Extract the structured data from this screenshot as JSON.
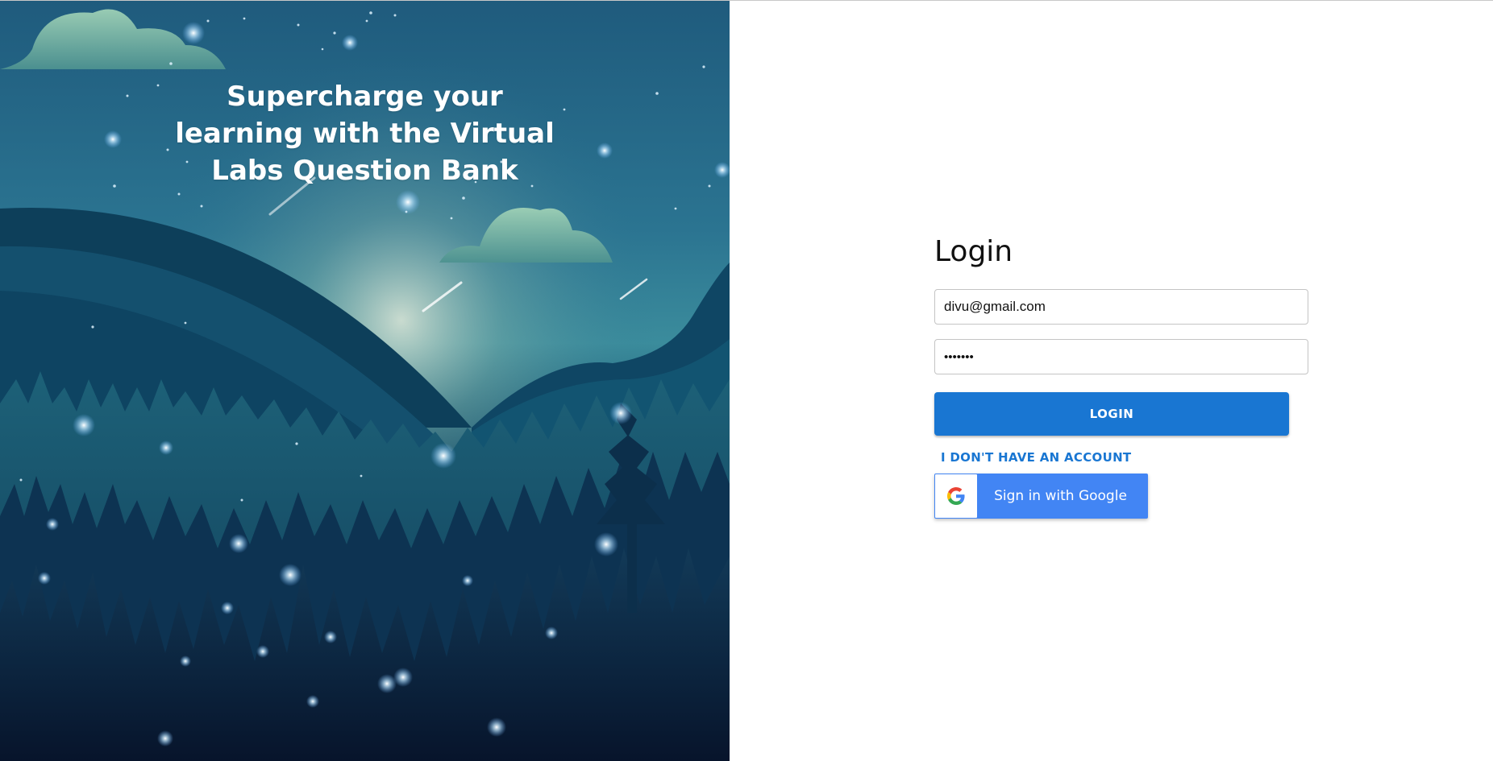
{
  "hero": {
    "title": "Supercharge your learning with the Virtual Labs Question Bank"
  },
  "login": {
    "title": "Login",
    "email_value": "divu@gmail.com",
    "password_value": "1234567",
    "login_button_label": "LOGIN",
    "no_account_label": "I DON'T HAVE AN ACCOUNT",
    "google_button_label": "Sign in with Google"
  },
  "colors": {
    "primary": "#1976d2",
    "google_blue": "#4285f4"
  },
  "icons": {
    "google": "google-g-icon"
  }
}
